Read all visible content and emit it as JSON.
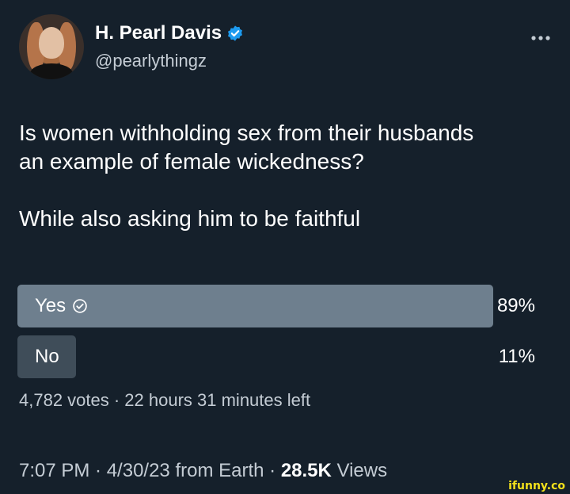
{
  "author": {
    "display_name": "H. Pearl Davis",
    "handle": "@pearlythingz"
  },
  "more_icon": "more-horizontal-icon",
  "tweet": {
    "line1": "Is women withholding sex from their husbands",
    "line2": "an example of female wickedness?",
    "line3": "While also asking him to be faithful"
  },
  "poll": {
    "options": [
      {
        "label": "Yes",
        "percent_label": "89%",
        "percent": 89,
        "winner": true
      },
      {
        "label": "No",
        "percent_label": "11%",
        "percent": 11,
        "winner": false
      }
    ],
    "meta": "4,782 votes · 22 hours 31 minutes left"
  },
  "footer": {
    "time_date": "7:07 PM · 4/30/23 from Earth · ",
    "views_count": "28.5K",
    "views_label": " Views"
  },
  "watermark": "ifunny.co",
  "colors": {
    "background": "#15202b",
    "verified": "#1d9bf0",
    "winner_bar": "#6e7f8e",
    "loser_bar": "#3f4d59"
  }
}
